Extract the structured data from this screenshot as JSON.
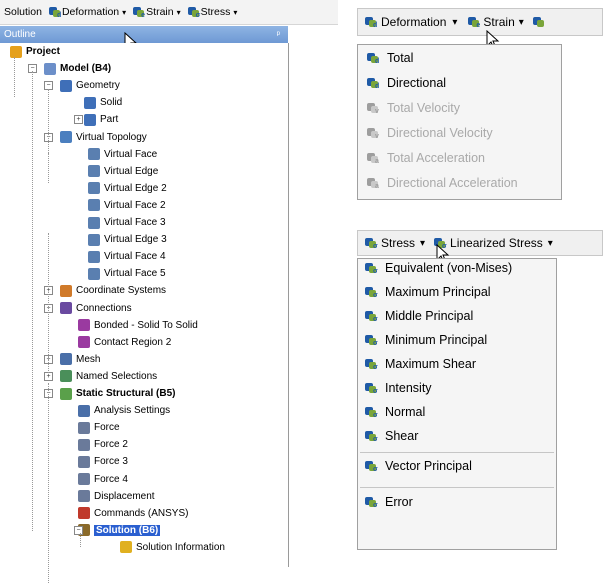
{
  "toolbar_left": {
    "solution_label": "Solution",
    "deformation_label": "Deformation",
    "strain_label": "Strain",
    "stress_label": "Stress",
    "dropdown_glyph": "▾"
  },
  "outline": {
    "title": "Outline",
    "pin_glyph": "ᵖ",
    "items": [
      {
        "label": "Project",
        "bold": true
      },
      {
        "label": "Model (B4)",
        "bold": true
      },
      {
        "label": "Geometry"
      },
      {
        "label": "Solid"
      },
      {
        "label": "Part"
      },
      {
        "label": "Virtual Topology"
      },
      {
        "label": "Virtual Face"
      },
      {
        "label": "Virtual Edge"
      },
      {
        "label": "Virtual Edge 2"
      },
      {
        "label": "Virtual Face 2"
      },
      {
        "label": "Virtual Face 3"
      },
      {
        "label": "Virtual Edge 3"
      },
      {
        "label": "Virtual Face 4"
      },
      {
        "label": "Virtual Face 5"
      },
      {
        "label": "Coordinate Systems"
      },
      {
        "label": "Connections"
      },
      {
        "label": "Bonded - Solid To Solid"
      },
      {
        "label": "Contact Region 2"
      },
      {
        "label": "Mesh"
      },
      {
        "label": "Named Selections"
      },
      {
        "label": "Static Structural (B5)",
        "bold": true
      },
      {
        "label": "Analysis Settings"
      },
      {
        "label": "Force"
      },
      {
        "label": "Force 2"
      },
      {
        "label": "Force 3"
      },
      {
        "label": "Force 4"
      },
      {
        "label": "Displacement"
      },
      {
        "label": "Commands (ANSYS)"
      },
      {
        "label": "Solution (B6)",
        "bold": true,
        "selected": true
      },
      {
        "label": "Solution Information"
      }
    ]
  },
  "deformation_menu": {
    "bar": {
      "deformation_label": "Deformation",
      "strain_label": "Strain",
      "dropdown_glyph": "▾"
    },
    "items": [
      {
        "label": "Total",
        "enabled": true,
        "sub": "d"
      },
      {
        "label": "Directional",
        "enabled": true,
        "sub": "d"
      },
      {
        "label": "Total Velocity",
        "enabled": false,
        "sub": "v"
      },
      {
        "label": "Directional Velocity",
        "enabled": false,
        "sub": "v"
      },
      {
        "label": "Total Acceleration",
        "enabled": false,
        "sub": "a"
      },
      {
        "label": "Directional Acceleration",
        "enabled": false,
        "sub": "a"
      }
    ]
  },
  "stress_menu": {
    "bar": {
      "stress_label": "Stress",
      "linearized_label": "Linearized Stress",
      "dropdown_glyph": "▾"
    },
    "items": [
      {
        "label": "Equivalent (von-Mises)"
      },
      {
        "label": "Maximum Principal"
      },
      {
        "label": "Middle Principal"
      },
      {
        "label": "Minimum Principal"
      },
      {
        "label": "Maximum Shear"
      },
      {
        "label": "Intensity"
      },
      {
        "label": "Normal"
      },
      {
        "label": "Shear"
      },
      {
        "label": "Vector Principal"
      },
      {
        "label": "Error"
      }
    ]
  },
  "colors": {
    "accent": "#1f5aa6",
    "green": "#7aa53a",
    "selection": "#2a5fd0",
    "disabled": "#a9a9a9"
  }
}
